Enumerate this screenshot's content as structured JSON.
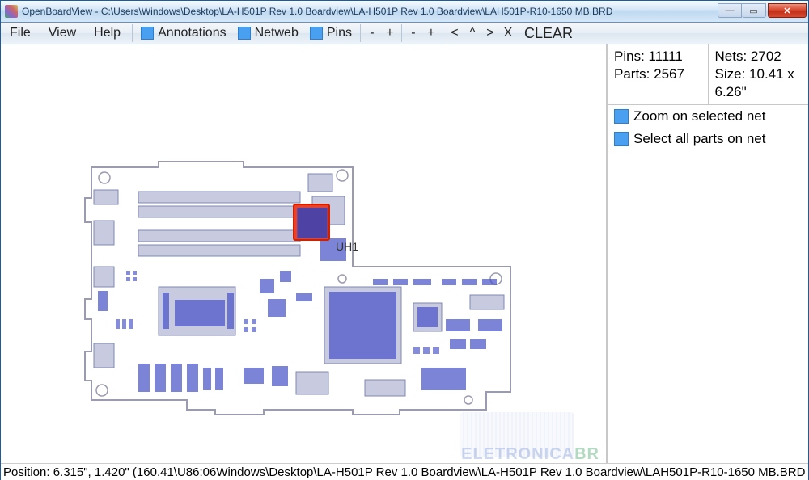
{
  "titlebar": {
    "app": "OpenBoardView",
    "path": "C:\\Users\\Windows\\Desktop\\LA-H501P Rev 1.0 Boardview\\LA-H501P Rev 1.0 Boardview\\LAH501P-R10-1650 MB.BRD"
  },
  "menu": {
    "file": "File",
    "view": "View",
    "help": "Help"
  },
  "toolbar": {
    "annotations": "Annotations",
    "netweb": "Netweb",
    "pins": "Pins",
    "minus1": "-",
    "plus1": "+",
    "minus2": "-",
    "plus2": "+",
    "lt": "<",
    "caret": "^",
    "gt": ">",
    "x": "X",
    "clear": "CLEAR"
  },
  "sidebar": {
    "pins_label": "Pins:",
    "pins_value": "11111",
    "parts_label": "Parts:",
    "parts_value": "2567",
    "nets_label": "Nets:",
    "nets_value": "2702",
    "size_label": "Size:",
    "size_value": "10.41 x 6.26\"",
    "opt_zoom": "Zoom on selected net",
    "opt_select_all": "Select all parts on net"
  },
  "board": {
    "selected_part": "UH1"
  },
  "statusbar": {
    "text": "Position: 6.315\", 1.420\" (160.41\\U86:06Windows\\Desktop\\LA-H501P Rev 1.0 Boardview\\LA-H501P Rev 1.0 Boardview\\LAH501P-R10-1650 MB.BRD"
  },
  "watermark": {
    "text1": "ELETRONICA",
    "text2": "BR"
  }
}
